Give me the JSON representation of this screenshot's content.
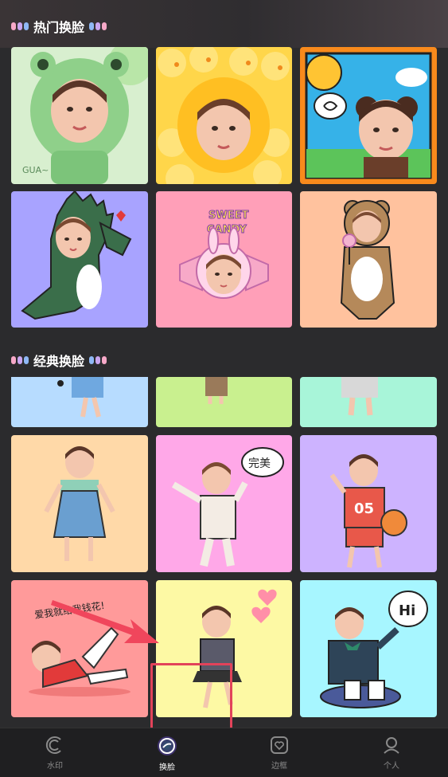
{
  "sections": {
    "hot": {
      "title": "热门换脸"
    },
    "classic": {
      "title": "经典换脸"
    }
  },
  "hot_items": [
    {
      "name": "frog-costume",
      "bg": "#d8efcf"
    },
    {
      "name": "duck-costume",
      "bg": "#ffd64a"
    },
    {
      "name": "bear-comic",
      "bg": "#f88a1c"
    },
    {
      "name": "dinosaur-costume",
      "bg": "#a8a3ff"
    },
    {
      "name": "sweet-candy",
      "bg": "#ff9fb8",
      "text1": "SWEET",
      "text2": "CANDY"
    },
    {
      "name": "bear-lollipop",
      "bg": "#ffc29e"
    }
  ],
  "classic_items": [
    {
      "name": "partial-blue",
      "bg": "#b7dcff"
    },
    {
      "name": "partial-green",
      "bg": "#c9f08f"
    },
    {
      "name": "partial-mint",
      "bg": "#a8f5d9"
    },
    {
      "name": "overalls-girl",
      "bg": "#ffd9a8"
    },
    {
      "name": "perfect-boy",
      "bg": "#ffa8e8",
      "bubble": "完美"
    },
    {
      "name": "basketball-05",
      "bg": "#cdb3ff",
      "jersey": "05"
    },
    {
      "name": "rich-lying",
      "bg": "#ff9a9a",
      "caption": "爱我就给我钱花!"
    },
    {
      "name": "school-girl-hearts",
      "bg": "#fdf9a4"
    },
    {
      "name": "hi-boy",
      "bg": "#a7f6ff",
      "bubble": "Hi"
    }
  ],
  "nav": [
    {
      "label": "水印",
      "icon": "watermark-icon"
    },
    {
      "label": "换脸",
      "icon": "face-swap-icon",
      "active": true
    },
    {
      "label": "边框",
      "icon": "heart-frame-icon"
    },
    {
      "label": "个人",
      "icon": "person-icon"
    }
  ],
  "colors": {
    "highlight": "#e2435a",
    "arrow": "#f0465c"
  }
}
